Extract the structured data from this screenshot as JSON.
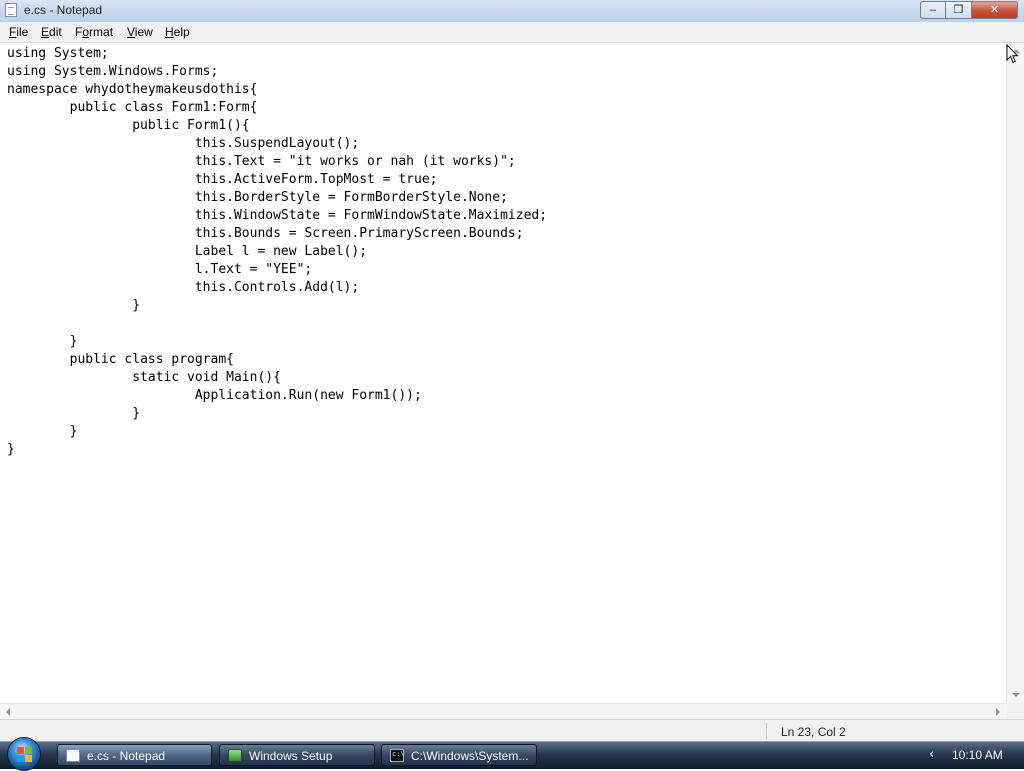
{
  "window": {
    "title": "e.cs - Notepad",
    "controls": {
      "minimize": "‒",
      "maximize": "❐",
      "close": "✕"
    }
  },
  "menu": [
    {
      "label": "File",
      "mnemonic": "F",
      "rest": "ile"
    },
    {
      "label": "Edit",
      "mnemonic": "E",
      "rest": "dit"
    },
    {
      "label": "Format",
      "mnemonic": "o",
      "pre": "F",
      "rest": "rmat"
    },
    {
      "label": "View",
      "mnemonic": "V",
      "rest": "iew"
    },
    {
      "label": "Help",
      "mnemonic": "H",
      "rest": "elp"
    }
  ],
  "editor": {
    "content": "using System;\nusing System.Windows.Forms;\nnamespace whydotheymakeusdothis{\n\tpublic class Form1:Form{\n\t\tpublic Form1(){\n\t\t\tthis.SuspendLayout();\n\t\t\tthis.Text = \"it works or nah (it works)\";\n\t\t\tthis.ActiveForm.TopMost = true;\n\t\t\tthis.BorderStyle = FormBorderStyle.None;\n\t\t\tthis.WindowState = FormWindowState.Maximized;\n\t\t\tthis.Bounds = Screen.PrimaryScreen.Bounds;\n\t\t\tLabel l = new Label();\n\t\t\tl.Text = \"YEE\";\n\t\t\tthis.Controls.Add(l);\n\t\t}\n\n\t}\n\tpublic class program{\n\t\tstatic void Main(){\n\t\t\tApplication.Run(new Form1());\n\t\t}\n\t}\n}"
  },
  "status_bar": {
    "position": "Ln 23, Col 2"
  },
  "taskbar": {
    "tasks": [
      {
        "label": "e.cs - Notepad",
        "icon": "notepad-icon",
        "active": true
      },
      {
        "label": "Windows Setup",
        "icon": "setup-icon",
        "active": false
      },
      {
        "label": "C:\\Windows\\System...",
        "icon": "cmd-icon",
        "active": false
      }
    ],
    "tray_chevron": "‹",
    "clock": "10:10 AM"
  }
}
